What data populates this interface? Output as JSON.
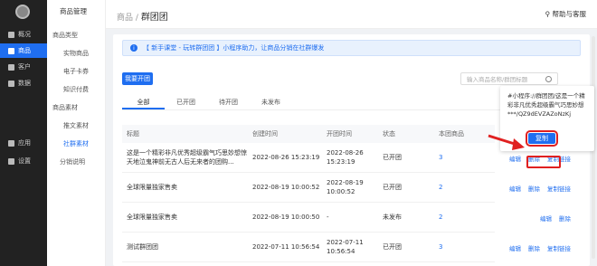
{
  "nav_primary": [
    {
      "label": "概况",
      "icon": "monitor-icon"
    },
    {
      "label": "商品",
      "icon": "bag-icon"
    },
    {
      "label": "客户",
      "icon": "user-icon"
    },
    {
      "label": "数据",
      "icon": "chart-icon"
    },
    {
      "label": "应用",
      "icon": "grid-icon"
    },
    {
      "label": "设置",
      "icon": "gear-icon"
    }
  ],
  "nav_secondary": {
    "title": "商品管理",
    "group1": "商品类型",
    "group1_items": [
      "实物商品",
      "电子卡券",
      "知识付费"
    ],
    "group2": "商品素材",
    "group2_items": [
      "推文素材",
      "社群素材"
    ],
    "other": "分销说明"
  },
  "header": {
    "crumb_parent": "商品",
    "crumb_sep": "/",
    "crumb_current": "群团团",
    "help": "帮助与客服"
  },
  "banner": {
    "text": "【 新手课堂 - 玩转群团团 】小程序助力，让商品分销在社群爆发"
  },
  "toolbar": {
    "open_button": "我要开团",
    "search_placeholder": "输入商品名称/群团标题"
  },
  "tabs": [
    "全部",
    "已开团",
    "待开团",
    "未发布"
  ],
  "table": {
    "columns": [
      "标题",
      "创建时间",
      "开团时间",
      "状态",
      "本团商品"
    ],
    "rows": [
      {
        "title": "这是一个精彩非凡优秀超级霸气巧思妙想惊天地泣鬼神前无古人后无来者的团购...",
        "created": "2022-08-26 15:23:19",
        "opened": "2022-08-26 15:23:19",
        "status": "已开团",
        "count": "3"
      },
      {
        "title": "全球限量独家售卖",
        "created": "2022-08-19 10:00:52",
        "opened": "2022-08-19 10:00:52",
        "status": "已开团",
        "count": "2"
      },
      {
        "title": "全球限量独家售卖",
        "created": "2022-08-19 10:00:50",
        "opened": "-",
        "status": "未发布",
        "count": "2"
      },
      {
        "title": "测试群团团",
        "created": "2022-07-11 10:56:54",
        "opened": "2022-07-11 10:56:54",
        "status": "已开团",
        "count": "3"
      }
    ],
    "ops": [
      "编辑",
      "删除",
      "复制链接"
    ]
  },
  "popover": {
    "text": "#小程序://群团团/这是一个精彩非凡优秀超级霸气巧思妙想***/QZ9dEVZAZoNzKj",
    "copy_button": "复制"
  },
  "colors": {
    "accent": "#1f6ef0",
    "highlight": "#e02020",
    "sidebar": "#222222"
  }
}
